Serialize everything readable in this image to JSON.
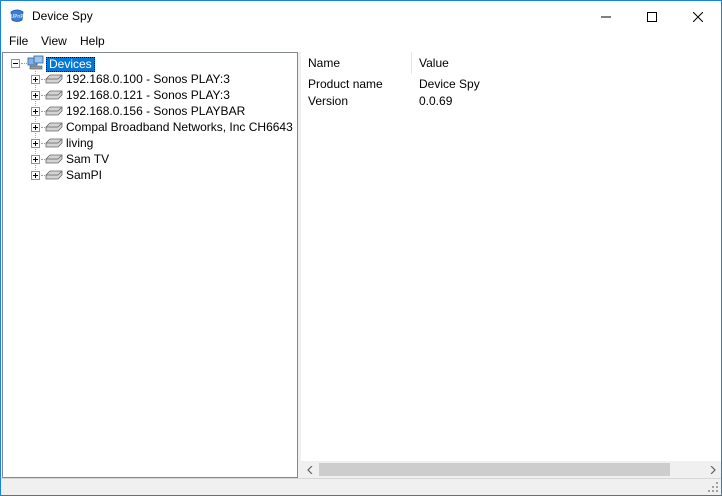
{
  "window": {
    "title": "Device Spy",
    "icon": "upnp-app-icon",
    "controls": {
      "minimize": "minimize-icon",
      "maximize": "maximize-icon",
      "close": "close-icon"
    }
  },
  "menu": {
    "items": [
      {
        "label": "File"
      },
      {
        "label": "View"
      },
      {
        "label": "Help"
      }
    ]
  },
  "tree": {
    "root": {
      "label": "Devices",
      "icon": "network-devices-icon",
      "expanded": true,
      "selected": true
    },
    "children": [
      {
        "label": "192.168.0.100 - Sonos PLAY:3",
        "icon": "device-icon"
      },
      {
        "label": "192.168.0.121 - Sonos PLAY:3",
        "icon": "device-icon"
      },
      {
        "label": "192.168.0.156 - Sonos PLAYBAR",
        "icon": "device-icon"
      },
      {
        "label": "Compal Broadband Networks, Inc CH6643",
        "icon": "device-icon"
      },
      {
        "label": "living",
        "icon": "device-icon"
      },
      {
        "label": "Sam TV",
        "icon": "device-icon"
      },
      {
        "label": "SamPI",
        "icon": "device-icon"
      }
    ]
  },
  "properties": {
    "columns": [
      "Name",
      "Value"
    ],
    "rows": [
      {
        "name": "Product name",
        "value": "Device Spy"
      },
      {
        "name": "Version",
        "value": "0.0.69"
      }
    ]
  },
  "colors": {
    "selection": "#0078d7",
    "window_border": "#1883d7",
    "chrome": "#f0f0f0"
  }
}
